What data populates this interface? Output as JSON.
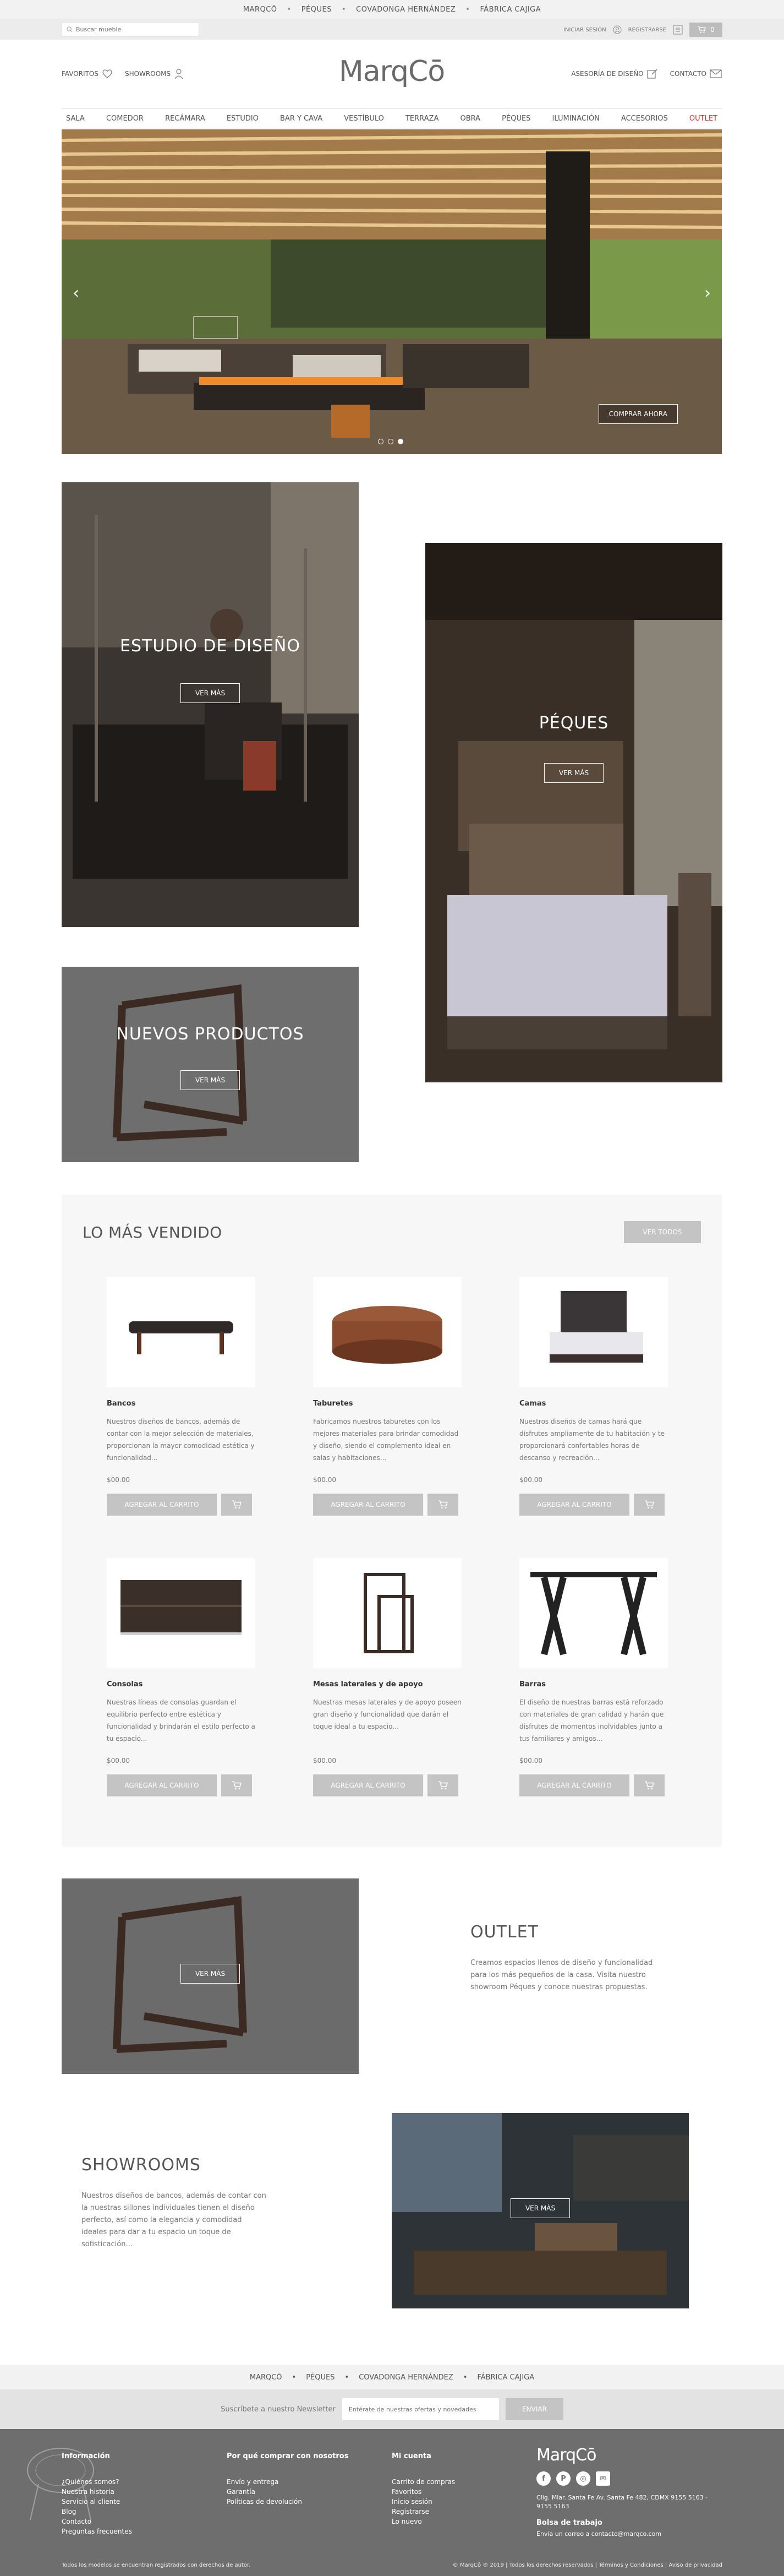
{
  "brand_bar": {
    "items": [
      "MARQCŌ",
      "PÉQUES",
      "COVADONGA HERNÁNDEZ",
      "FÁBRICA CAJIGA"
    ]
  },
  "util": {
    "search_placeholder": "Buscar mueble",
    "login": "INICIAR SESIÓN",
    "register": "REGISTRARSE",
    "cart_count": "0"
  },
  "header": {
    "logo": "MarqCō",
    "favorites": "FAVORITOS",
    "showrooms": "SHOWROOMS",
    "design_advice": "ASESORÍA DE DISEÑO",
    "contact": "CONTACTO"
  },
  "nav": [
    "SALA",
    "COMEDOR",
    "RECÁMARA",
    "ESTUDIO",
    "BAR Y CAVA",
    "VESTÍBULO",
    "TERRAZA",
    "OBRA",
    "PÉQUES",
    "ILUMINACIÓN",
    "ACCESORIOS",
    "OUTLET"
  ],
  "hero": {
    "cta": "COMPRAR AHORA"
  },
  "tiles": {
    "studio": {
      "title": "ESTUDIO DE DISEÑO",
      "cta": "VER MÁS"
    },
    "peques": {
      "title": "PÉQUES",
      "cta": "VER MÁS"
    },
    "new": {
      "title": "NUEVOS PRODUCTOS",
      "cta": "VER MÁS"
    }
  },
  "best": {
    "title": "LO MÁS VENDIDO",
    "view_all": "VER TODOS",
    "add_label": "AGREGAR AL CARRITO",
    "products": [
      {
        "name": "Bancos",
        "desc": "Nuestros diseños de bancos, además de contar con la mejor selección de materiales, proporcionan la mayor comodidad estética y funcionalidad...",
        "price": "$00.00"
      },
      {
        "name": "Taburetes",
        "desc": "Fabricamos nuestros taburetes con los mejores materiales para brindar comodidad y diseño, siendo el complemento ideal en salas y habitaciones...",
        "price": "$00.00"
      },
      {
        "name": "Camas",
        "desc": "Nuestros diseños de camas hará que disfrutes ampliamente de tu habitación y te proporcionará confortables horas de descanso y recreación...",
        "price": "$00.00"
      },
      {
        "name": "Consolas",
        "desc": "Nuestras líneas de consolas guardan el equilibrio perfecto entre estética y funcionalidad y brindarán el estilo perfecto a tu espacio...",
        "price": "$00.00"
      },
      {
        "name": "Mesas laterales y de apoyo",
        "desc": "Nuestras mesas laterales y de apoyo poseen gran diseño y funcionalidad que darán el toque ideal a tu espacio...",
        "price": "$00.00"
      },
      {
        "name": "Barras",
        "desc": "El diseño de nuestras barras está reforzado con materiales de gran calidad y harán que disfrutes de momentos inolvidables junto a tus familiares y amigos...",
        "price": "$00.00"
      }
    ]
  },
  "outlet": {
    "title": "OUTLET",
    "text": "Creamos espacios llenos de diseño y funcionalidad para los más pequeños de la casa. Visita nuestro showroom Péques y conoce nuestras propuestas.",
    "cta": "VER MÁS"
  },
  "showrooms": {
    "title": "SHOWROOMS",
    "text": "Nuestros diseños de bancos, además de contar con la nuestras sillones individuales tienen el diseño perfecto, así como la elegancia y comodidad ideales para dar a tu espacio un toque de sofisticación...",
    "cta": "VER MÁS"
  },
  "newsletter": {
    "label": "Suscríbete a nuestro Newsletter",
    "placeholder": "Entérate de nuestras ofertas y novedades",
    "button": "ENVIAR"
  },
  "footer": {
    "info": {
      "title": "Información",
      "items": [
        "¿Quiénes somos?",
        "Nuestra historia",
        "Servicio al cliente",
        "Blog",
        "Contacto",
        "Preguntas frecuentes"
      ]
    },
    "why": {
      "title": "Por qué comprar con nosotros",
      "items": [
        "Envío y entrega",
        "Garantía",
        "Políticas de devolución"
      ]
    },
    "account": {
      "title": "Mi cuenta",
      "items": [
        "Carrito de compras",
        "Favoritos",
        "Inicio sesión",
        "Registrarse",
        "Lo nuevo"
      ]
    },
    "logo": "MarqCō",
    "address": "Clig. Mlar. Santa Fe Av. Santa Fe 482, CDMX 9155 5163 - 9155 5163",
    "jobs_title": "Bolsa de trabajo",
    "jobs_text": "Envía un correo a contacto@marqco.com",
    "legal_left": "Todos los modelos se encuentran registrados con derechos de autor.",
    "legal_right": "© MarqCō ® 2019 | Todos los derechos reservados | Términos y Condiciones | Aviso de privacidad"
  },
  "colors": {
    "outlet_nav": "#c0392b",
    "button_grey": "#c4c4c4",
    "footer": "#6e6e6e"
  }
}
